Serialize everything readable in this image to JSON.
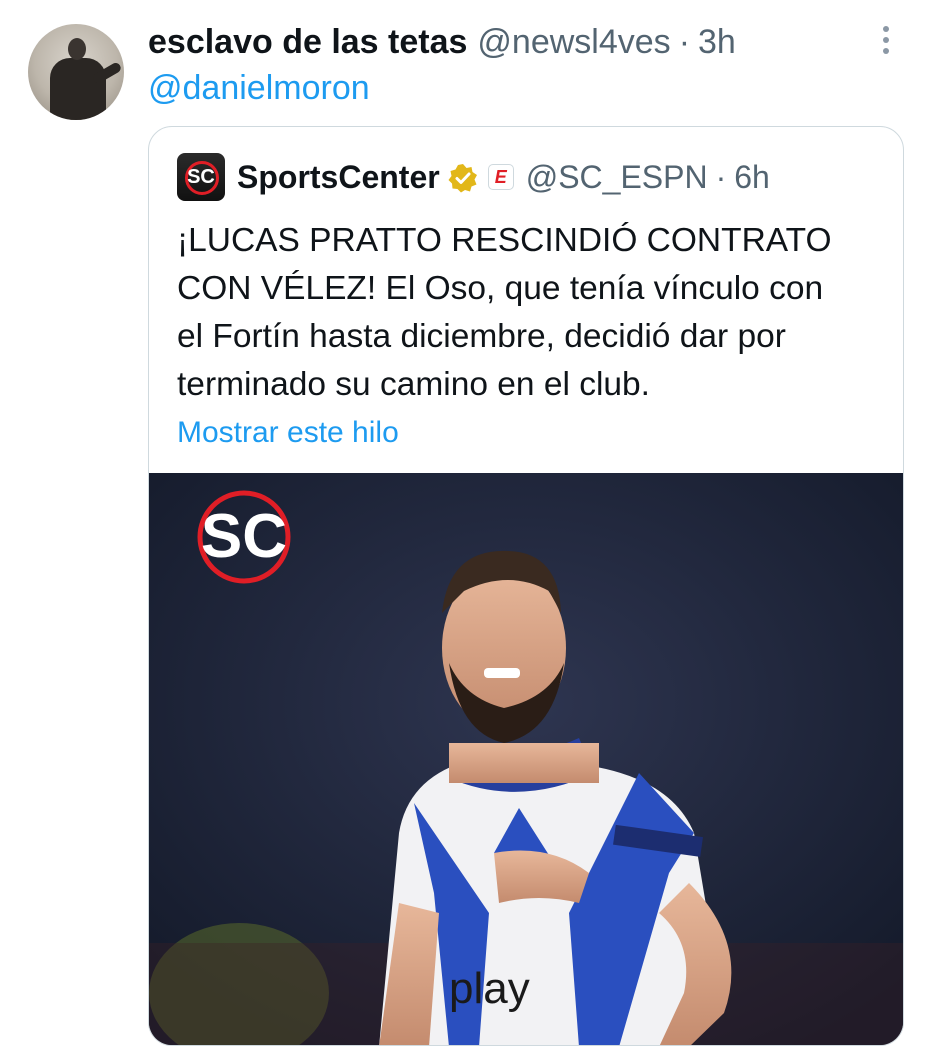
{
  "tweet": {
    "display_name": "esclavo de las tetas",
    "handle": "@newsl4ves",
    "separator": "·",
    "time": "3h",
    "reply_mention": "@danielmoron"
  },
  "quote": {
    "display_name": "SportsCenter",
    "handle": "@SC_ESPN",
    "separator": "·",
    "time": "6h",
    "avatar_logo": "SC",
    "badge_logo": "E",
    "text": "¡LUCAS PRATTO RESCINDIÓ CONTRATO\nCON VÉLEZ! El Oso, que tenía vínculo con\nel Fortín hasta diciembre, decidió dar por\nterminado su camino en el club.",
    "show_thread": "Mostrar este hilo",
    "media": {
      "logo_text": "SC",
      "jersey_text": "play"
    }
  },
  "icons": {
    "more": "more-vertical-icon",
    "verified": "verified-gold-check-icon",
    "affiliate": "espn-badge-icon"
  },
  "colors": {
    "link": "#1d9bf0",
    "muted": "#536471",
    "verified_gold": "#e2b719",
    "espn_red": "#e01e26"
  }
}
